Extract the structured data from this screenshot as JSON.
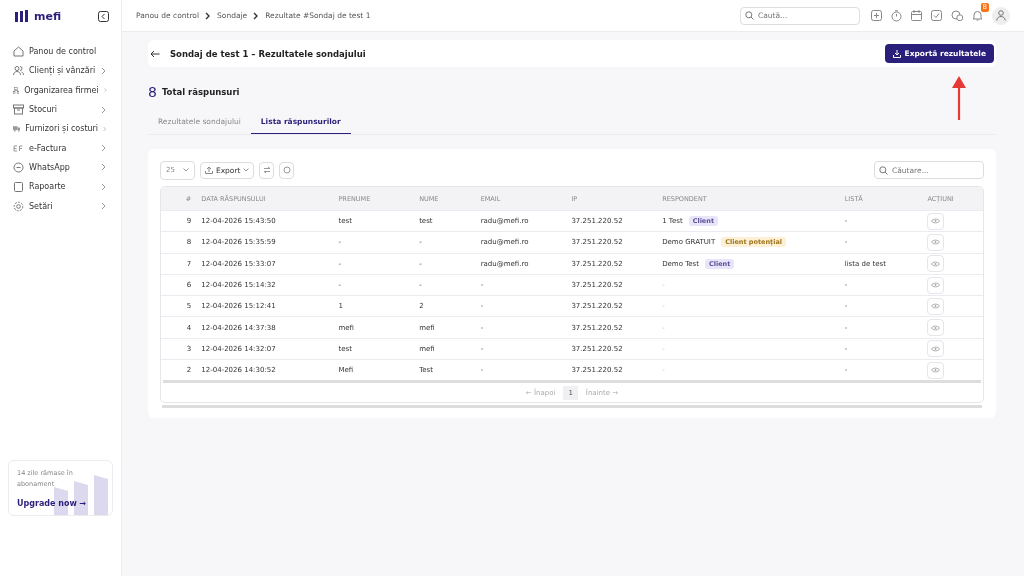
{
  "brand": "mefi",
  "sidebar": {
    "items": [
      {
        "label": "Panou de control",
        "has_children": false
      },
      {
        "label": "Clienți și vânzări",
        "has_children": true
      },
      {
        "label": "Organizarea firmei",
        "has_children": true
      },
      {
        "label": "Stocuri",
        "has_children": true
      },
      {
        "label": "Furnizori și costuri",
        "has_children": true
      },
      {
        "label": "e-Factura",
        "has_children": true
      },
      {
        "label": "WhatsApp",
        "has_children": true
      },
      {
        "label": "Rapoarte",
        "has_children": true
      },
      {
        "label": "Setări",
        "has_children": true
      }
    ],
    "promo": {
      "text": "14 zile rămase în abonament",
      "link": "Upgrade now →"
    }
  },
  "breadcrumbs": [
    "Panou de control",
    "Sondaje",
    "Rezultate #Sondaj de test 1"
  ],
  "search": {
    "placeholder": "Caută..."
  },
  "notifications": "8",
  "header": {
    "title": "Sondaj de test 1 – Rezultatele sondajului",
    "export_button": "Exportă rezultatele"
  },
  "total": {
    "count": "8",
    "label": "Total răspunsuri"
  },
  "tabs": [
    {
      "label": "Rezultatele sondajului",
      "selected": false
    },
    {
      "label": "Lista răspunsurilor",
      "selected": true
    }
  ],
  "toolbar": {
    "page_size": "25",
    "export": "Export",
    "search_placeholder": "Căutare..."
  },
  "table": {
    "columns": [
      "#",
      "DATA RĂSPUNSULUI",
      "PRENUME",
      "NUME",
      "EMAIL",
      "IP",
      "RESPONDENT",
      "LISTĂ",
      "ACȚIUNI"
    ],
    "rows": [
      {
        "id": "9",
        "date": "12-04-2026 15:43:50",
        "first": "test",
        "last": "test",
        "email": "radu@mefi.ro",
        "ip": "37.251.220.52",
        "respondent": "1 Test",
        "tag": {
          "label": "Client",
          "color": "#e8e5fb"
        },
        "list": "-"
      },
      {
        "id": "8",
        "date": "12-04-2026 15:35:59",
        "first": "-",
        "last": "-",
        "email": "radu@mefi.ro",
        "ip": "37.251.220.52",
        "respondent": "Demo GRATUIT",
        "tag": {
          "label": "Client potențial",
          "color": "#fdf0d5"
        },
        "list": "-"
      },
      {
        "id": "7",
        "date": "12-04-2026 15:33:07",
        "first": "-",
        "last": "-",
        "email": "radu@mefi.ro",
        "ip": "37.251.220.52",
        "respondent": "Demo Test",
        "tag": {
          "label": "Client",
          "color": "#e8e5fb"
        },
        "list": "lista de test"
      },
      {
        "id": "6",
        "date": "12-04-2026 15:14:32",
        "first": "-",
        "last": "-",
        "email": "-",
        "ip": "37.251.220.52",
        "respondent": "-",
        "list": "-"
      },
      {
        "id": "5",
        "date": "12-04-2026 15:12:41",
        "first": "1",
        "last": "2",
        "email": "-",
        "ip": "37.251.220.52",
        "respondent": "-",
        "list": "-"
      },
      {
        "id": "4",
        "date": "12-04-2026 14:37:38",
        "first": "mefi",
        "last": "mefi",
        "email": "-",
        "ip": "37.251.220.52",
        "respondent": "-",
        "list": "-"
      },
      {
        "id": "3",
        "date": "12-04-2026 14:32:07",
        "first": "test",
        "last": "mefi",
        "email": "-",
        "ip": "37.251.220.52",
        "respondent": "-",
        "list": "-"
      },
      {
        "id": "2",
        "date": "12-04-2026 14:30:52",
        "first": "Mefi",
        "last": "Test",
        "email": "-",
        "ip": "37.251.220.52",
        "respondent": "-",
        "list": "-"
      }
    ]
  },
  "pagination": {
    "prev": "← Înapoi",
    "pages": [
      {
        "label": "1",
        "selected": true
      }
    ],
    "next": "Înainte →"
  }
}
